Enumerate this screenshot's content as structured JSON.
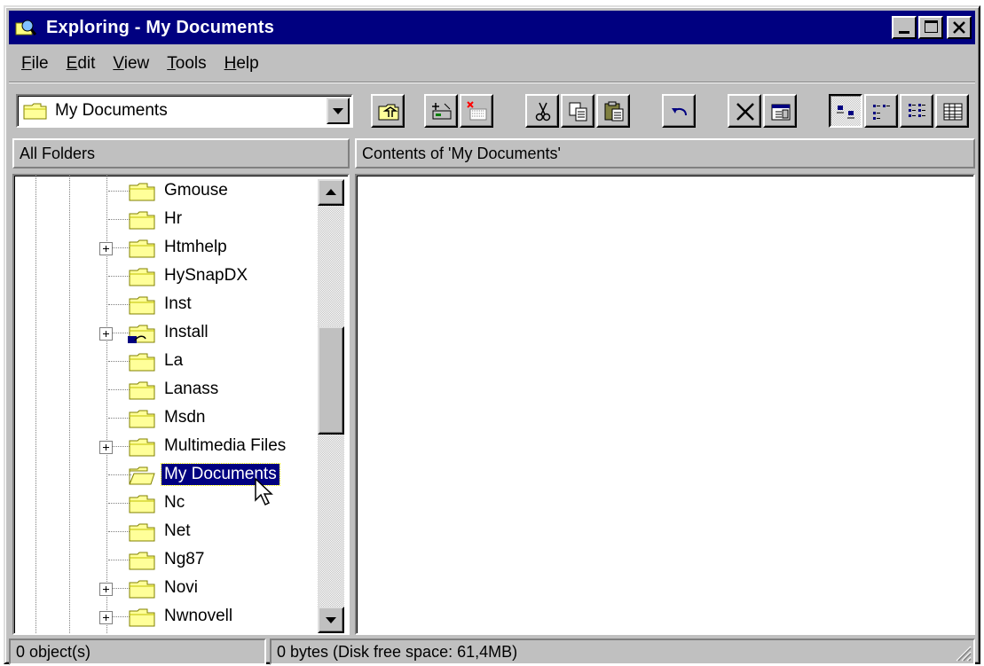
{
  "window": {
    "title": "Exploring - My Documents",
    "title_bar_color": "#000080",
    "face_color": "#c0c0c0"
  },
  "menu": [
    {
      "key": "F",
      "rest": "ile"
    },
    {
      "key": "E",
      "rest": "dit"
    },
    {
      "key": "V",
      "rest": "iew"
    },
    {
      "key": "T",
      "rest": "ools"
    },
    {
      "key": "H",
      "rest": "elp"
    }
  ],
  "address": {
    "value": "My Documents",
    "icon": "folder-icon"
  },
  "toolbar": {
    "buttons": [
      {
        "name": "up-one-level-button",
        "icon": "up-folder-icon"
      },
      {
        "name": "map-network-drive-button",
        "icon": "map-drive-icon"
      },
      {
        "name": "disconnect-drive-button",
        "icon": "disconnect-drive-icon"
      },
      {
        "name": "cut-button",
        "icon": "scissors-icon"
      },
      {
        "name": "copy-button",
        "icon": "copy-icon"
      },
      {
        "name": "paste-button",
        "icon": "paste-icon"
      },
      {
        "name": "undo-button",
        "icon": "undo-icon"
      },
      {
        "name": "delete-button",
        "icon": "delete-x-icon"
      },
      {
        "name": "properties-button",
        "icon": "properties-icon"
      },
      {
        "name": "large-icons-button",
        "icon": "large-icons-icon",
        "pressed": true
      },
      {
        "name": "small-icons-button",
        "icon": "small-icons-icon"
      },
      {
        "name": "list-button",
        "icon": "list-icon"
      },
      {
        "name": "details-button",
        "icon": "details-icon"
      }
    ]
  },
  "panes": {
    "left_header": "All Folders",
    "right_header": "Contents of 'My Documents'"
  },
  "tree": {
    "items": [
      {
        "label": "Gmouse",
        "expandable": false,
        "selected": false
      },
      {
        "label": "Hr",
        "expandable": false,
        "selected": false
      },
      {
        "label": "Htmhelp",
        "expandable": true,
        "selected": false
      },
      {
        "label": "HySnapDX",
        "expandable": false,
        "selected": false
      },
      {
        "label": "Inst",
        "expandable": false,
        "selected": false
      },
      {
        "label": "Install",
        "expandable": true,
        "selected": false,
        "icon": "shared-folder-icon"
      },
      {
        "label": "La",
        "expandable": false,
        "selected": false
      },
      {
        "label": "Lanass",
        "expandable": false,
        "selected": false
      },
      {
        "label": "Msdn",
        "expandable": false,
        "selected": false
      },
      {
        "label": "Multimedia Files",
        "expandable": true,
        "selected": false
      },
      {
        "label": "My Documents",
        "expandable": false,
        "selected": true,
        "icon": "open-folder-icon"
      },
      {
        "label": "Nc",
        "expandable": false,
        "selected": false
      },
      {
        "label": "Net",
        "expandable": false,
        "selected": false
      },
      {
        "label": "Ng87",
        "expandable": false,
        "selected": false
      },
      {
        "label": "Novi",
        "expandable": true,
        "selected": false
      },
      {
        "label": "Nwnovell",
        "expandable": true,
        "selected": false
      }
    ]
  },
  "status": {
    "objects": "0 object(s)",
    "space": "0 bytes (Disk free space: 61,4MB)"
  }
}
